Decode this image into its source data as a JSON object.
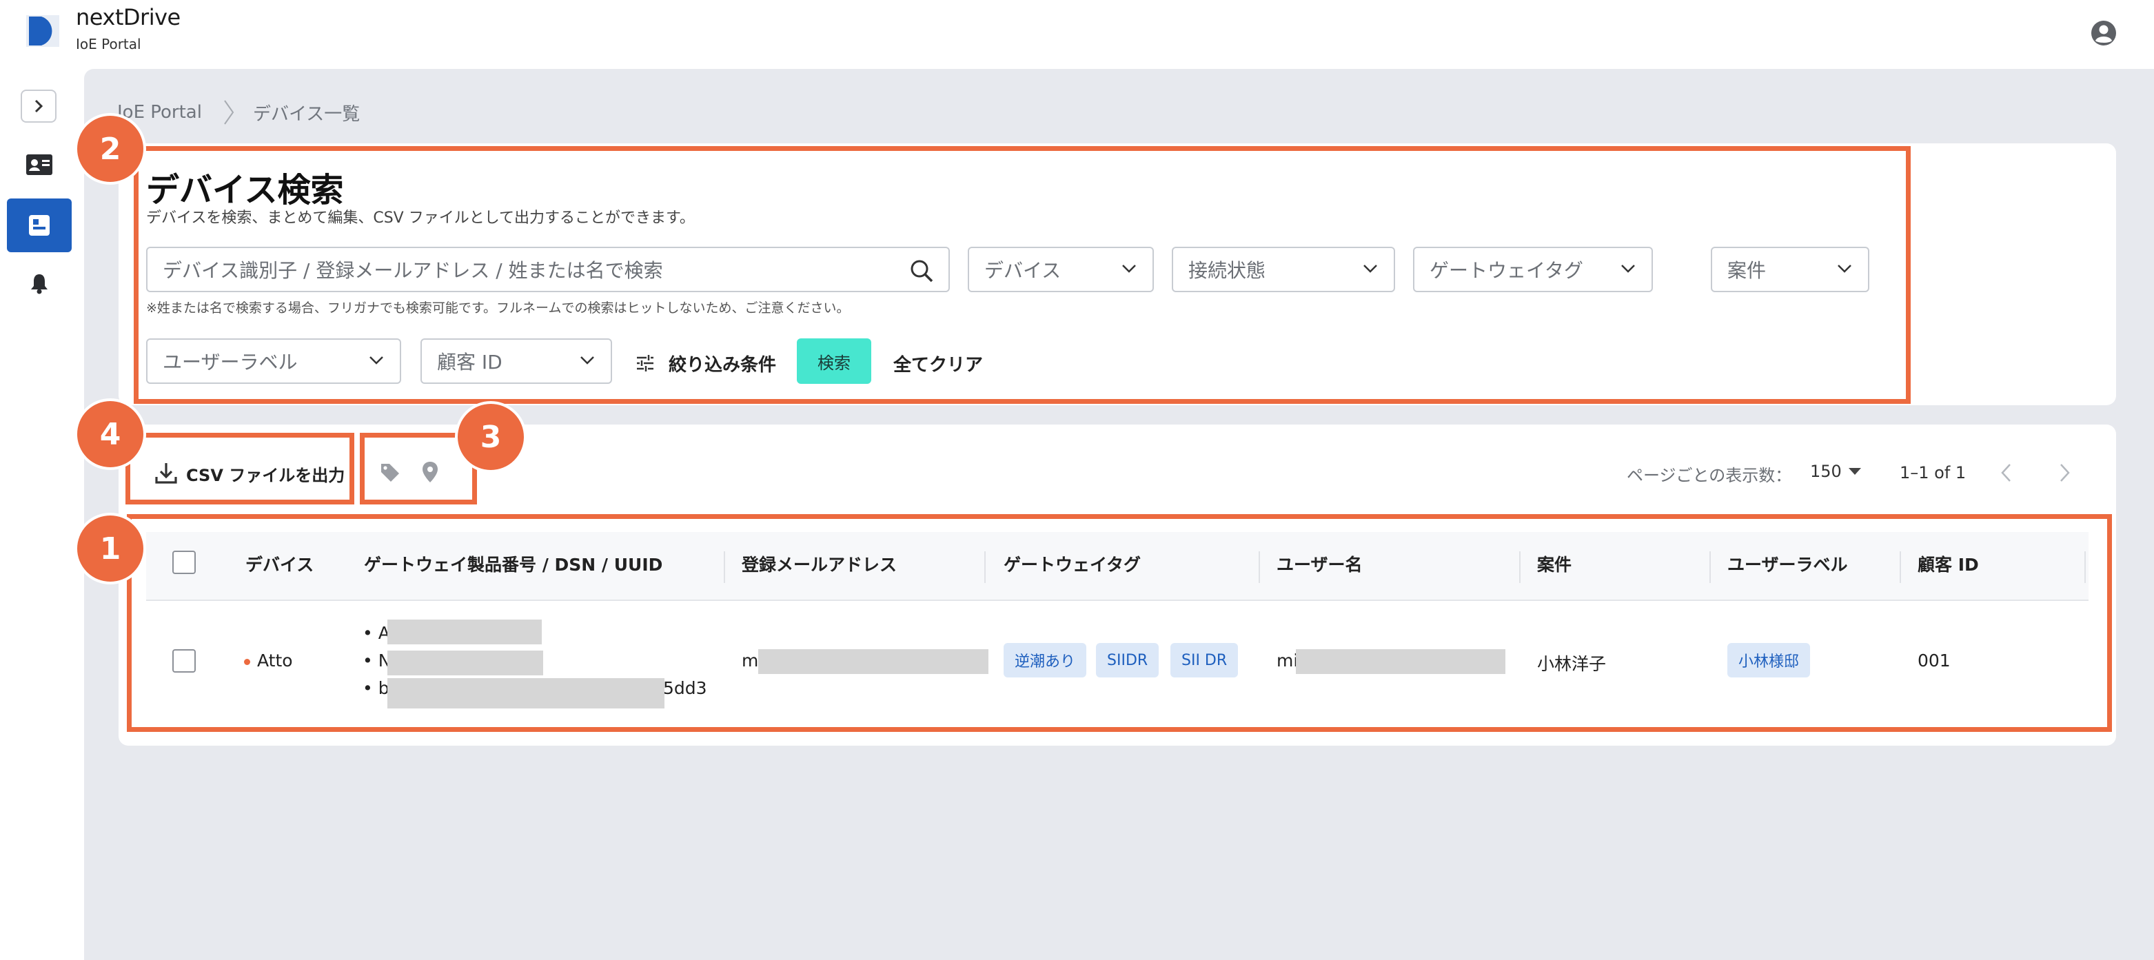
{
  "app": {
    "name": "nextDrive",
    "subtitle": "IoE Portal"
  },
  "breadcrumb": {
    "root": "IoE Portal",
    "current": "デバイス一覧"
  },
  "search": {
    "title": "デバイス検索",
    "description": "デバイスを検索、まとめて編集、CSV ファイルとして出力することができます。",
    "query_placeholder": "デバイス識別子 / 登録メールアドレス / 姓または名で検索",
    "note": "※姓または名で検索する場合、フリガナでも検索可能です。フルネームでの検索はヒットしないため、ご注意ください。",
    "dropdowns": {
      "device": "デバイス",
      "connection": "接続状態",
      "gateway_tag": "ゲートウェイタグ",
      "project": "案件",
      "user_label": "ユーザーラベル",
      "customer_id": "顧客 ID"
    },
    "filter_label": "絞り込み条件",
    "search_label": "検索",
    "clear_label": "全てクリア"
  },
  "toolbar": {
    "csv_label": "CSV ファイルを出力",
    "page_size_label": "ページごとの表示数：",
    "page_size": "150",
    "range": "1–1 of 1"
  },
  "table": {
    "columns": {
      "device": "デバイス",
      "gateway": "ゲートウェイ製品番号 / DSN / UUID",
      "email": "登録メールアドレス",
      "gateway_tag": "ゲートウェイタグ",
      "user_name": "ユーザー名",
      "project": "案件",
      "user_label": "ユーザーラベル",
      "customer_id": "顧客 ID"
    },
    "rows": [
      {
        "device": "Atto",
        "status_color": "#ec6a3f",
        "gateway_ids": {
          "serial": "• A(",
          "dsn": "• N",
          "uuid_prefix": "• b1",
          "uuid_suffix": "5dd3"
        },
        "email": "mi",
        "gateway_tags": [
          "逆潮あり",
          "SIIDR",
          "SII DR"
        ],
        "user_name": "mi",
        "project": "小林洋子",
        "user_label": "小林様邸",
        "customer_id": "001"
      }
    ]
  },
  "annotations": {
    "table": "1",
    "search": "2",
    "icons": "3",
    "csv": "4"
  },
  "colors": {
    "accent_blue": "#1e5fbe",
    "search_button": "#47e6cf",
    "annotation": "#ec6a3f",
    "main_bg": "#e7e9ee"
  },
  "icons": [
    "logo-mark",
    "account-icon",
    "chevron-right-icon",
    "contact-card-icon",
    "dashboard-icon",
    "bell-icon",
    "search-icon",
    "chevron-down-icon",
    "tune-icon",
    "download-icon",
    "tag-icon",
    "location-pin-icon",
    "chevron-left-icon"
  ]
}
